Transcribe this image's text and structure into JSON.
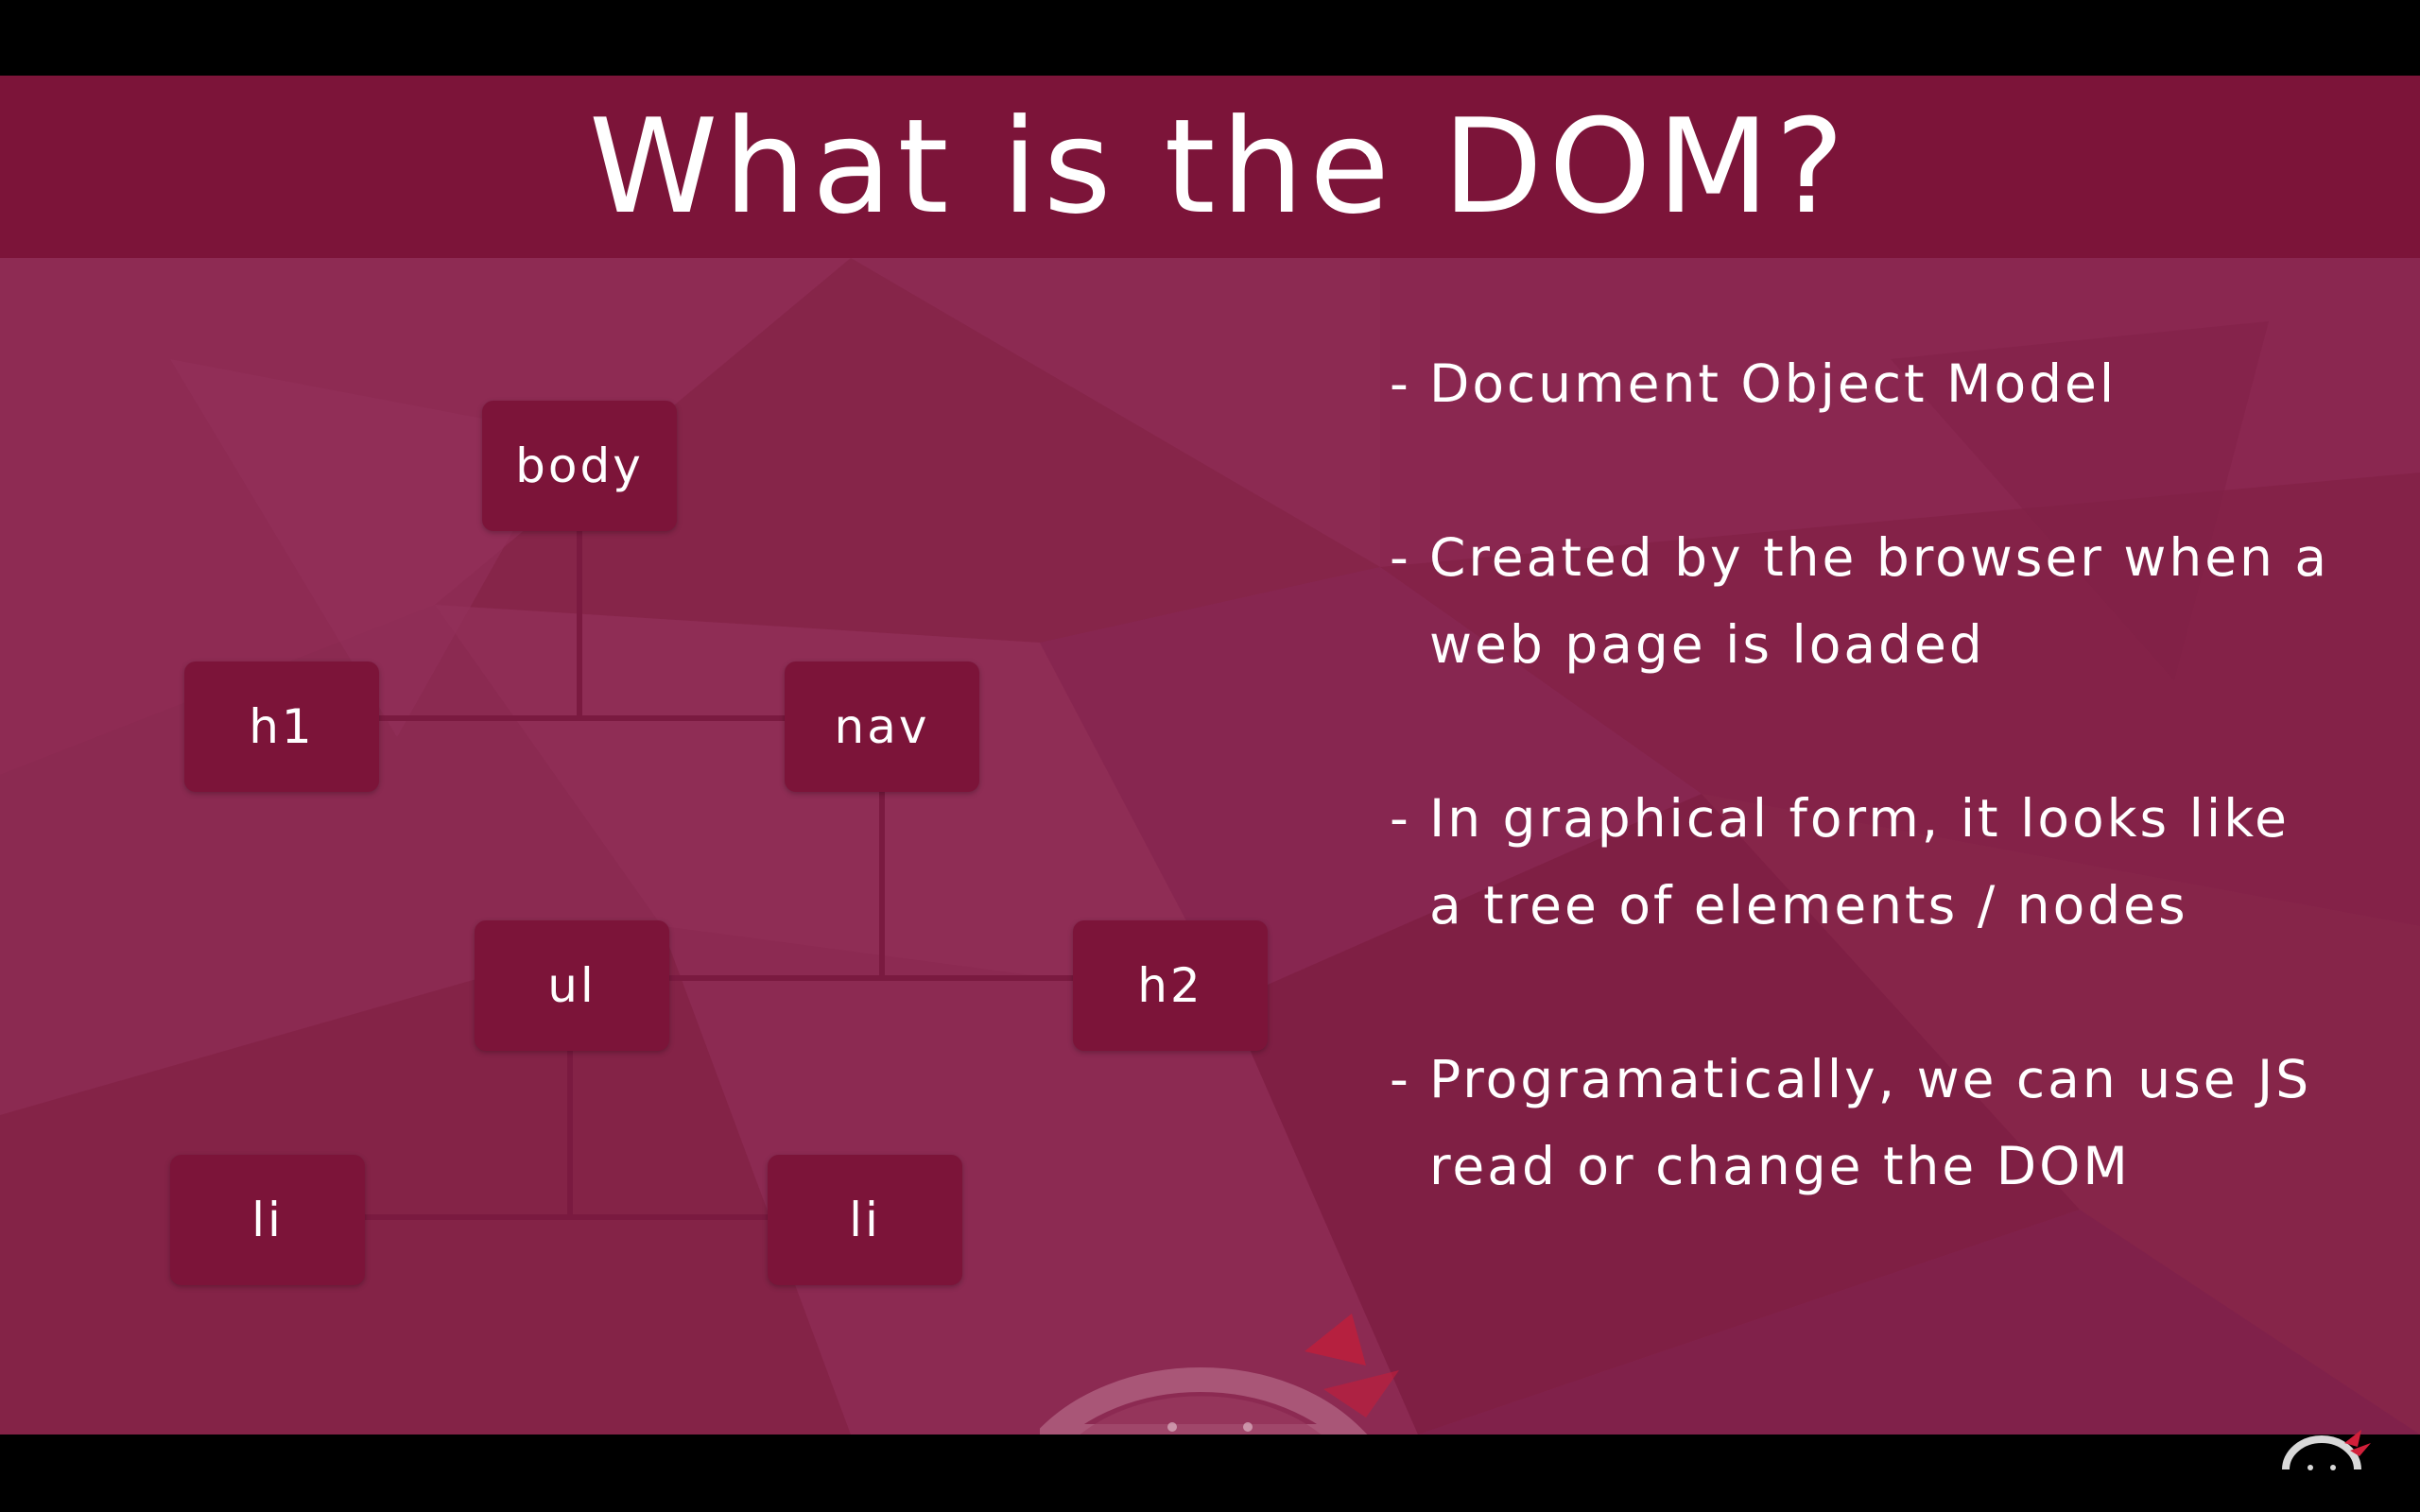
{
  "slide": {
    "title": "What is the DOM?",
    "colors": {
      "background": "#8c2a52",
      "title_bar": "#7c1439",
      "node_fill": "#7c1439",
      "connector": "#7a1a40",
      "text": "#ffffff"
    },
    "tree": {
      "nodes": [
        {
          "id": "body",
          "label": "body"
        },
        {
          "id": "h1",
          "label": "h1"
        },
        {
          "id": "nav",
          "label": "nav"
        },
        {
          "id": "ul",
          "label": "ul"
        },
        {
          "id": "h2",
          "label": "h2"
        },
        {
          "id": "li-1",
          "label": "li"
        },
        {
          "id": "li-2",
          "label": "li"
        }
      ],
      "edges": [
        [
          "body",
          "h1"
        ],
        [
          "body",
          "nav"
        ],
        [
          "nav",
          "ul"
        ],
        [
          "nav",
          "h2"
        ],
        [
          "ul",
          "li-1"
        ],
        [
          "ul",
          "li-2"
        ]
      ]
    },
    "bullets": [
      {
        "dash": "-",
        "lines": [
          "Document Object Model"
        ]
      },
      {
        "dash": "-",
        "lines": [
          "Created by the browser when a",
          "web page is loaded"
        ]
      },
      {
        "dash": "-",
        "lines": [
          "In graphical form, it looks like",
          "a tree of elements / nodes"
        ]
      },
      {
        "dash": "-",
        "lines": [
          "Programatically, we can use JS",
          "read or change the DOM"
        ]
      }
    ]
  },
  "icons": {
    "mascot": "ninja-mascot-icon",
    "corner": "ninja-logo-icon"
  }
}
